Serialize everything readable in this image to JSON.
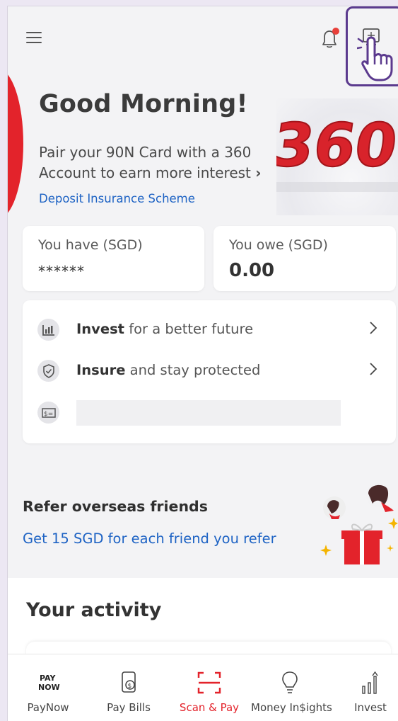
{
  "header": {
    "menu_icon": "hamburger-menu-icon",
    "notification_icon": "bell-icon",
    "notification_badge_color": "#E8403A",
    "screenshot_icon": "scan-screen-icon"
  },
  "promo": {
    "badge_text": "360",
    "greeting": "Good Morning!",
    "message": "Pair your 90N Card with a 360 Account to earn more interest",
    "message_chevron": "›",
    "deposit_link": "Deposit Insurance Scheme"
  },
  "balances": {
    "have_label": "You have (SGD)",
    "have_value": "******",
    "owe_label": "You owe (SGD)",
    "owe_value": "0.00"
  },
  "quick_links": [
    {
      "icon": "bar-chart-icon",
      "bold": "Invest",
      "rest": " for a better future"
    },
    {
      "icon": "shield-check-icon",
      "bold": "Insure",
      "rest": " and stay protected"
    },
    {
      "icon": "dollar-bill-icon"
    }
  ],
  "refer": {
    "title": "Refer overseas friends",
    "link": "Get 15 SGD for each friend you refer"
  },
  "activity": {
    "title": "Your activity"
  },
  "bottom_nav": [
    {
      "label": "PayNow",
      "icon": "paynow-logo-icon",
      "icon_text_top": "PAY",
      "icon_text_bottom": "NOW"
    },
    {
      "label": "Pay Bills",
      "icon": "bill-dollar-icon"
    },
    {
      "label": "Scan & Pay",
      "icon": "scan-frame-icon",
      "active": true
    },
    {
      "label": "Money In$ights",
      "icon": "lightbulb-icon"
    },
    {
      "label": "Invest",
      "icon": "invest-growth-icon"
    }
  ],
  "colors": {
    "accent": "#E3232B",
    "link": "#1E63C4",
    "highlight_border": "#5B3A8E"
  }
}
